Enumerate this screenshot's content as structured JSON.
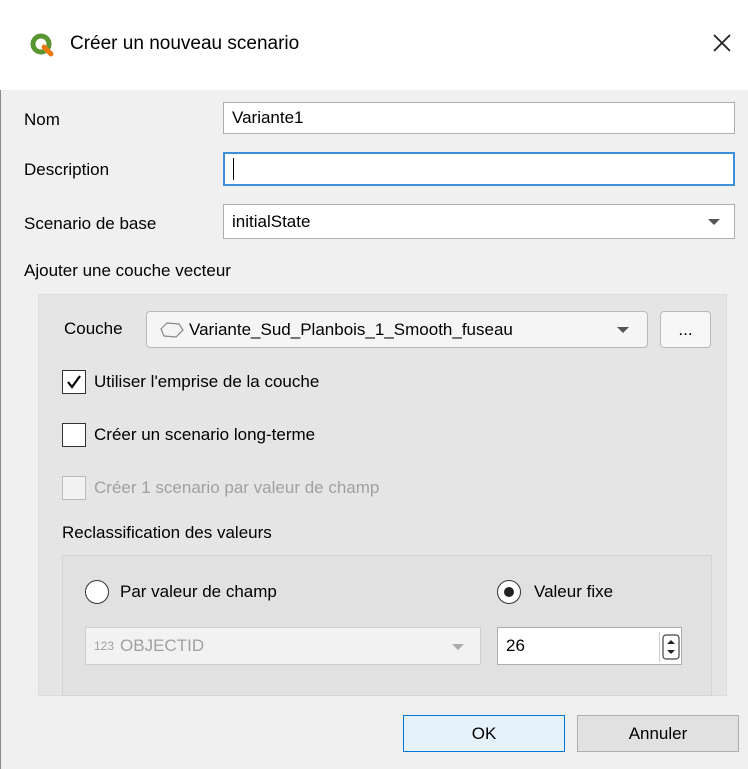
{
  "window": {
    "title": "Créer un nouveau scenario",
    "icons": {
      "app": "qgis-logo-icon",
      "close": "close-icon"
    }
  },
  "form": {
    "nom_label": "Nom",
    "nom_value": "Variante1",
    "description_label": "Description",
    "description_value": "",
    "scenario_base_label": "Scenario de base",
    "scenario_base_value": "initialState"
  },
  "vector_group": {
    "title": "Ajouter une couche vecteur",
    "couche_label": "Couche",
    "couche_value": "Variante_Sud_Planbois_1_Smooth_fuseau",
    "browse_label": "...",
    "checkboxes": [
      {
        "label": "Utiliser l'emprise de la couche",
        "checked": true,
        "enabled": true
      },
      {
        "label": "Créer un scenario long-terme",
        "checked": false,
        "enabled": true
      },
      {
        "label": "Créer 1 scenario par valeur de champ",
        "checked": false,
        "enabled": false
      }
    ]
  },
  "reclass_group": {
    "title": "Reclassification des valeurs",
    "radio_field_label": "Par valeur de champ",
    "radio_fixed_label": "Valeur fixe",
    "selected": "Valeur fixe",
    "field_type_badge": "123",
    "field_value": "OBJECTID",
    "fixed_value": "26"
  },
  "buttons": {
    "ok": "OK",
    "cancel": "Annuler"
  },
  "colors": {
    "accent": "#0078d7",
    "focus_border": "#3e8fd8",
    "qgis_green": "#589632",
    "qgis_yellow": "#ee7913"
  }
}
